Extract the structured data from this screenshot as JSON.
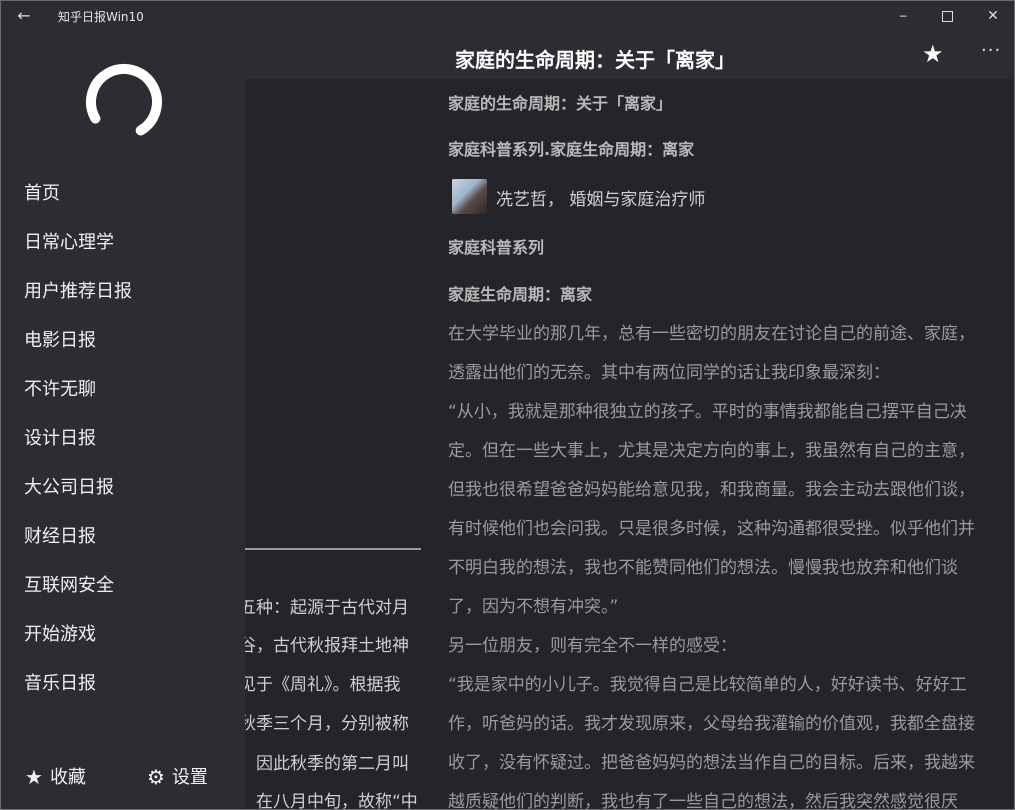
{
  "titlebar": {
    "back_icon": "←",
    "app_title": "知乎日报Win10",
    "minimize_icon": "─",
    "close_icon": "✕"
  },
  "sidebar": {
    "items": [
      {
        "label": "首页"
      },
      {
        "label": "日常心理学"
      },
      {
        "label": "用户推荐日报"
      },
      {
        "label": "电影日报"
      },
      {
        "label": "不许无聊"
      },
      {
        "label": "设计日报"
      },
      {
        "label": "大公司日报"
      },
      {
        "label": "财经日报"
      },
      {
        "label": "互联网安全"
      },
      {
        "label": "开始游戏"
      },
      {
        "label": "音乐日报"
      }
    ],
    "favorites": {
      "icon": "★",
      "label": "收藏"
    },
    "settings": {
      "icon": "⚙",
      "label": "设置"
    }
  },
  "list_panel": {
    "lines": [
      "五种：起源于古代对月",
      "谷，古代秋报拜土地神",
      "见于《周礼》。根据我",
      "秋季三个月，分别被称",
      "，因此秋季的第二月叫",
      "，在八月中旬，故称“中"
    ]
  },
  "header": {
    "title": "家庭的生命周期：关于「离家」",
    "star_icon": "★",
    "more_icon": "···"
  },
  "article": {
    "heading1": "家庭的生命周期：关于「离家」",
    "heading2": "家庭科普系列.家庭生命周期：离家",
    "author": "冼艺哲， 婚姻与家庭治疗师",
    "heading3": "家庭科普系列",
    "heading4": "家庭生命周期：离家",
    "lines": [
      "在大学毕业的那几年，总有一些密切的朋友在讨论自己的前途、家庭，",
      "透露出他们的无奈。其中有两位同学的话让我印象最深刻：",
      "“从小，我就是那种很独立的孩子。平时的事情我都能自己摆平自己决",
      "定。但在一些大事上，尤其是决定方向的事上，我虽然有自己的主意，",
      "但我也很希望爸爸妈妈能给意见我，和我商量。我会主动去跟他们谈，",
      "有时候他们也会问我。只是很多时候，这种沟通都很受挫。似乎他们并",
      "不明白我的想法，我也不能赞同他们的想法。慢慢我也放弃和他们谈",
      "了，因为不想有冲突。”",
      "另一位朋友，则有完全不一样的感受：",
      "“我是家中的小儿子。我觉得自己是比较简单的人，好好读书、好好工",
      "作，听爸妈的话。我才发现原来，父母给我灌输的价值观，我都全盘接",
      "收了，没有怀疑过。把爸爸妈妈的想法当作自己的目标。后来，我越来",
      "越质疑他们的判断，我也有了一些自己的想法，然后我突然感觉很厌"
    ]
  }
}
